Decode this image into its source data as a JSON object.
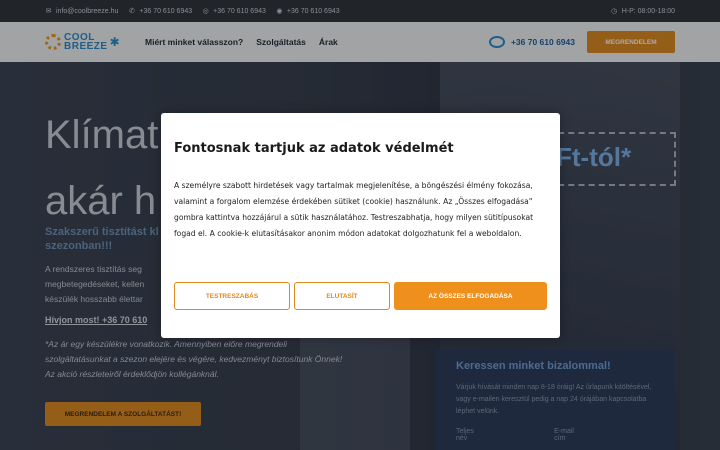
{
  "topbar": {
    "email": "info@coolbreeze.hu",
    "phone1": "+36 70 610 6943",
    "phone2": "+36 70 610 6943",
    "phone3": "+36 70 610 6943",
    "hours": "H-P: 08:00-18:00"
  },
  "nav": {
    "logo_line1": "COOL",
    "logo_line2": "BREEZE",
    "links": [
      "Miért minket válasszon?",
      "Szolgáltatás",
      "Árak"
    ],
    "phone": "+36 70 610 6943",
    "cta": "MEGRENDELEM"
  },
  "hero": {
    "title_line1": "Klímat",
    "title_line2": "akár h",
    "price_fragment": "Ft-tól*",
    "subtitle": "Szakszerű tisztítást kl szezonban!!!",
    "body": "A rendszeres tisztítás seg megbetegedéseket, kellen készülék hosszabb élettar",
    "call_now": "Hívjon most! +36 70 610",
    "note": "*Az ár egy készülékre vonatkozik. Amennyiben előre megrendeli szolgáltatásunkat a szezon elejére és végére, kedvezményt biztosítunk Önnek! Az akció részleteiről érdeklődjön kollégánknál.",
    "cta": "MEGRENDELEM A SZOLGÁLTATÁST!"
  },
  "contact": {
    "title": "Keressen minket bizalommal!",
    "text": "Várjuk hívását minden nap 8-18 óráig! Az űrlapunk kitöltésével, vagy e-mailen keresztül pedig a nap 24 órájában kapcsolatba léphet velünk.",
    "field1": "Teljes név",
    "field2": "E-mail cím"
  },
  "cookie": {
    "title": "Fontosnak tartjuk az adatok védelmét",
    "text": "A személyre szabott hirdetések vagy tartalmak megjelenítése, a böngészési élmény fokozása, valamint a forgalom elemzése érdekében sütiket (cookie) használunk. Az „Összes elfogadása\" gombra kattintva hozzájárul a sütik használatához. Testreszabhatja, hogy milyen sütitípusokat fogad el. A cookie-k elutasításakor anonim módon adatokat dolgozhatunk fel a weboldalon.",
    "btn_customize": "TESTRESZABÁS",
    "btn_reject": "ELUTASÍT",
    "btn_accept": "AZ ÖSSZES ELFOGADÁSA"
  },
  "colors": {
    "accent": "#e08a1d",
    "brand_blue": "#2a8bc8"
  }
}
